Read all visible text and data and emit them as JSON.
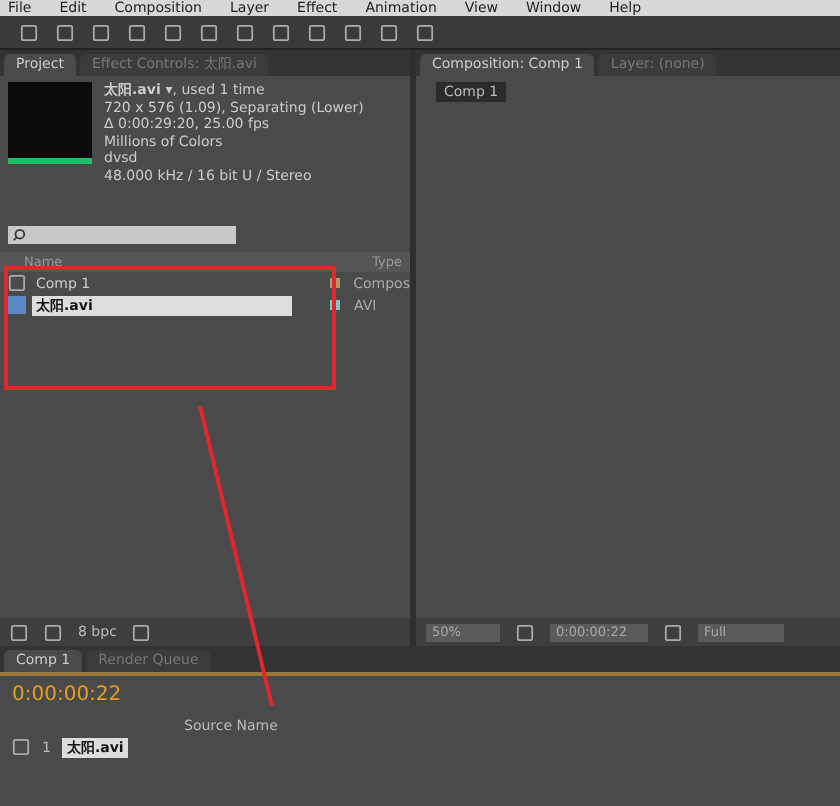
{
  "menu_bar": [
    "File",
    "Edit",
    "Composition",
    "Layer",
    "Effect",
    "Animation",
    "View",
    "Window",
    "Help"
  ],
  "project_panel": {
    "tabs": [
      {
        "label": "Project",
        "selected": true
      },
      {
        "label": "Effect Controls: 太阳.avi",
        "selected": false
      }
    ],
    "info": {
      "name": "太阳.avi ▾",
      "usage": ", used 1 time",
      "lines": [
        "720 x 576 (1.09), Separating (Lower)",
        "Δ 0:00:29:20, 25.00 fps",
        "Millions of Colors",
        "dvsd",
        "48.000 kHz / 16 bit U / Stereo"
      ]
    },
    "columns": [
      "Name",
      "Type"
    ],
    "rows": [
      {
        "kind": "composition",
        "name": "Comp 1",
        "type": "Compos",
        "color": "#b09a6a",
        "selected": false
      },
      {
        "kind": "footage",
        "name": "太阳.avi",
        "type": "AVI",
        "color": "#7fc8c8",
        "selected": true
      }
    ],
    "bit_depth": "8 bpc"
  },
  "composition_panel": {
    "tabs": [
      {
        "label": "Composition: Comp 1",
        "selected": true
      },
      {
        "label": "Layer: (none)",
        "selected": false
      }
    ],
    "comp_button": "Comp 1",
    "zoom": "50%",
    "timecode": "0:00:00:22",
    "resolution": "Full"
  },
  "timeline": {
    "tabs": [
      {
        "label": "Comp 1",
        "selected": true
      },
      {
        "label": "Render Queue",
        "selected": false
      }
    ],
    "timecode": "0:00:00:22",
    "source_name_header": "Source Name",
    "layers": [
      {
        "number": "1",
        "name": "太阳.avi"
      }
    ]
  }
}
